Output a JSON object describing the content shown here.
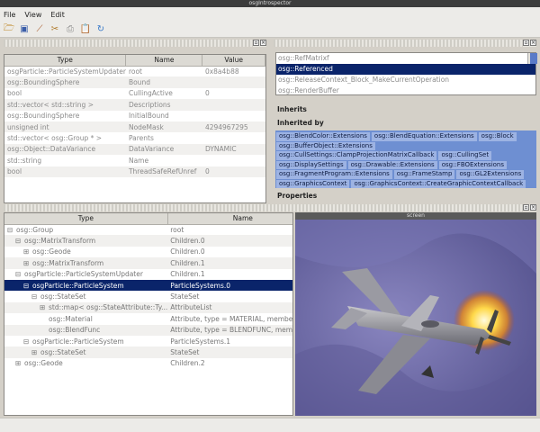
{
  "window": {
    "title": "osgIntrospector"
  },
  "menu": [
    "File",
    "View",
    "Edit"
  ],
  "toolbar_icons": [
    "open-icon",
    "save-icon",
    "wand-icon",
    "tools-icon",
    "stamp-icon",
    "clipboard-icon",
    "refresh-icon"
  ],
  "properties_table": {
    "columns": [
      "Type",
      "Name",
      "Value"
    ],
    "rows": [
      {
        "type": "osgParticle::ParticleSystemUpdater",
        "name": "root",
        "value": "0x8a4b88"
      },
      {
        "type": "osg::BoundingSphere",
        "name": "Bound",
        "value": ""
      },
      {
        "type": "bool",
        "name": "CullingActive",
        "value": "0"
      },
      {
        "type": "std::vector< std::string >",
        "name": "Descriptions",
        "value": ""
      },
      {
        "type": "osg::BoundingSphere",
        "name": "InitialBound",
        "value": ""
      },
      {
        "type": "unsigned int",
        "name": "NodeMask",
        "value": "4294967295"
      },
      {
        "type": "std::vector< osg::Group * >",
        "name": "Parents",
        "value": ""
      },
      {
        "type": "osg::Object::DataVariance",
        "name": "DataVariance",
        "value": "DYNAMIC"
      },
      {
        "type": "std::string",
        "name": "Name",
        "value": ""
      },
      {
        "type": "bool",
        "name": "ThreadSafeRefUnref",
        "value": "0"
      }
    ]
  },
  "class_list": {
    "items": [
      "osg::RefMatrixf",
      "osg::Referenced",
      "osg::ReleaseContext_Block_MakeCurrentOperation",
      "osg::RenderBuffer"
    ],
    "selected_index": 1
  },
  "sections": {
    "inherits": "Inherits",
    "inherited_by": "Inherited by",
    "properties": "Properties"
  },
  "inherited_by_tags": [
    "osg::BlendColor::Extensions",
    "osg::BlendEquation::Extensions",
    "osg::Block",
    "osg::BufferObject::Extensions",
    "osg::CullSettings::ClampProjectionMatrixCallback",
    "osg::CullingSet",
    "osg::DisplaySettings",
    "osg::Drawable::Extensions",
    "osg::FBOExtensions",
    "osg::FragmentProgram::Extensions",
    "osg::FrameStamp",
    "osg::GL2Extensions",
    "osg::GraphicsContext",
    "osg::GraphicsContext::CreateGraphicContextCallback"
  ],
  "scene_tree": {
    "columns": [
      "Type",
      "Name"
    ],
    "rows": [
      {
        "expander": "⊟",
        "type": "osg::Group",
        "name": "root",
        "depth": 0
      },
      {
        "expander": "⊟",
        "type": "osg::MatrixTransform",
        "name": "Children.0",
        "depth": 1
      },
      {
        "expander": "⊞",
        "type": "osg::Geode",
        "name": "Children.0",
        "depth": 2
      },
      {
        "expander": "⊞",
        "type": "osg::MatrixTransform",
        "name": "Children.1",
        "depth": 2
      },
      {
        "expander": "⊟",
        "type": "osgParticle::ParticleSystemUpdater",
        "name": "Children.1",
        "depth": 1
      },
      {
        "expander": "⊟",
        "type": "osgParticle::ParticleSystem",
        "name": "ParticleSystems.0",
        "depth": 2,
        "selected": true
      },
      {
        "expander": "⊟",
        "type": "osg::StateSet",
        "name": "StateSet",
        "depth": 3
      },
      {
        "expander": "⊞",
        "type": "std::map< osg::StateAttribute::Ty...",
        "name": "AttributeList",
        "depth": 4
      },
      {
        "expander": "",
        "type": "osg::Material",
        "name": "Attribute, type = MATERIAL, member = 0",
        "depth": 4
      },
      {
        "expander": "",
        "type": "osg::BlendFunc",
        "name": "Attribute, type = BLENDFUNC, member = 0",
        "depth": 4
      },
      {
        "expander": "⊟",
        "type": "osgParticle::ParticleSystem",
        "name": "ParticleSystems.1",
        "depth": 2
      },
      {
        "expander": "⊞",
        "type": "osg::StateSet",
        "name": "StateSet",
        "depth": 3
      },
      {
        "expander": "⊞",
        "type": "osg::Geode",
        "name": "Children.2",
        "depth": 1
      }
    ]
  },
  "viewer": {
    "title": "screen"
  },
  "colors": {
    "selection": "#0a246a",
    "tag_area": "#6e8fd2",
    "tag": "#9db3e3"
  }
}
